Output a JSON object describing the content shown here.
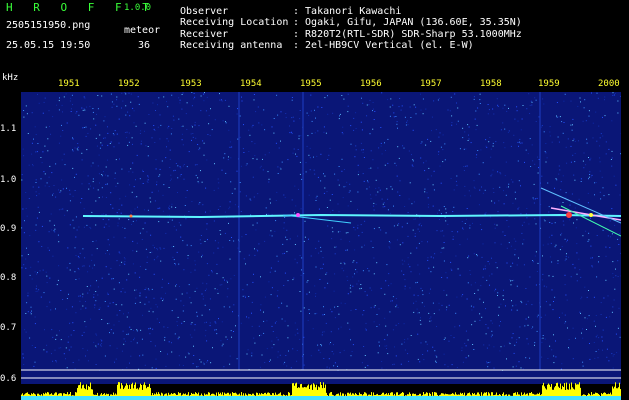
{
  "header": {
    "app_title": "H R O F F T",
    "app_version": "1.0.0",
    "file_name": "2505151950.png",
    "date_time": "25.05.15 19:50",
    "meteor_label": "meteor",
    "meteor_count": "36"
  },
  "station_info": [
    {
      "key": "Observer",
      "value": ": Takanori Kawachi"
    },
    {
      "key": "Receiving Location",
      "value": ": Ogaki, Gifu, JAPAN (136.60E, 35.35N)"
    },
    {
      "key": "Receiver",
      "value": ": R820T2(RTL-SDR) SDR-Sharp 53.1000MHz"
    },
    {
      "key": "Receiving antenna",
      "value": ": 2el-HB9CV Vertical (el. E-W)"
    }
  ],
  "y_axis": {
    "unit": "kHz",
    "ticks": [
      "1.1",
      "1.0",
      "0.9",
      "0.8",
      "0.7",
      "0.6"
    ]
  },
  "x_axis": {
    "ticks": [
      "1951",
      "1952",
      "1953",
      "1954",
      "1955",
      "1956",
      "1957",
      "1958",
      "1959",
      "2000"
    ]
  },
  "colors": {
    "header_green": "#39ff39",
    "noise_blue": "#0a1a8a",
    "trace_cyan": "#4ff3ff",
    "level_yellow": "#ffff00",
    "text_white": "#ffffff"
  }
}
